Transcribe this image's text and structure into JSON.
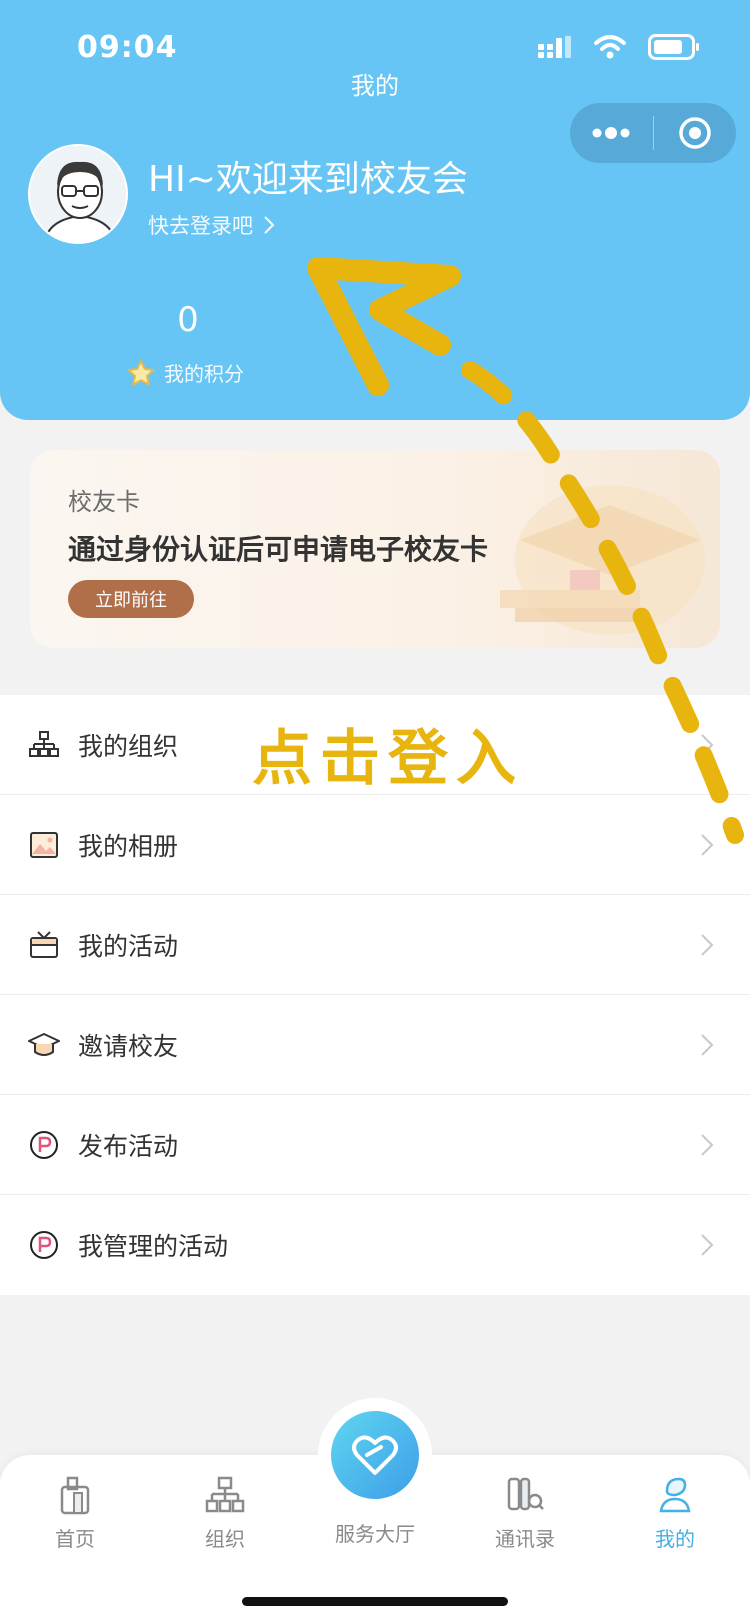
{
  "status": {
    "time": "09:04"
  },
  "nav": {
    "title": "我的"
  },
  "profile": {
    "welcome": "HI~欢迎来到校友会",
    "login_prompt": "快去登录吧"
  },
  "points": {
    "value": "0",
    "label": "我的积分"
  },
  "alumni_card": {
    "title": "校友卡",
    "description": "通过身份认证后可申请电子校友卡",
    "button": "立即前往"
  },
  "menu": [
    {
      "label": "我的组织",
      "icon": "org-icon"
    },
    {
      "label": "我的相册",
      "icon": "album-icon"
    },
    {
      "label": "我的活动",
      "icon": "gift-box-icon"
    },
    {
      "label": "邀请校友",
      "icon": "graduation-cap-icon"
    },
    {
      "label": "发布活动",
      "icon": "publish-badge-icon"
    },
    {
      "label": "我管理的活动",
      "icon": "manage-badge-icon"
    }
  ],
  "annotation": {
    "text": "点击登入",
    "color": "#e8b40e"
  },
  "tabbar": {
    "tabs": [
      {
        "label": "首页",
        "icon": "home-building-icon"
      },
      {
        "label": "组织",
        "icon": "org-tree-icon"
      },
      {
        "label": "服务大厅",
        "icon": "heart-badge-icon"
      },
      {
        "label": "通讯录",
        "icon": "contacts-search-icon"
      },
      {
        "label": "我的",
        "icon": "profile-icon"
      }
    ],
    "active_index": 4,
    "active_color": "#43b0e6"
  },
  "colors": {
    "header": "#66c5f4",
    "card_button": "#b06f49"
  }
}
